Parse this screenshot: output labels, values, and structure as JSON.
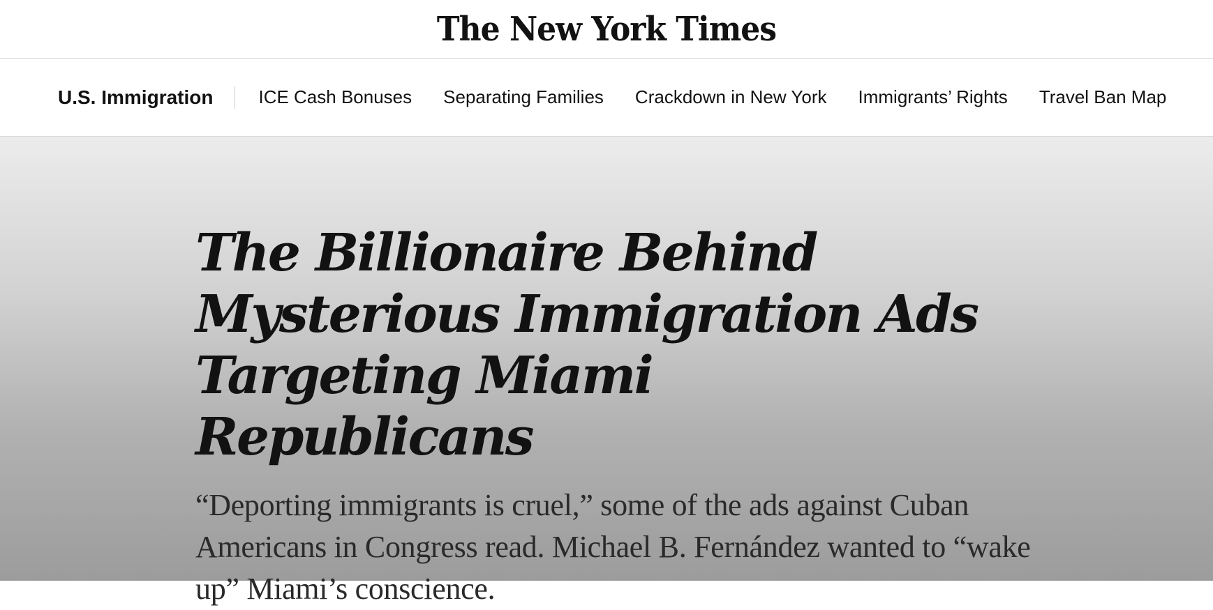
{
  "masthead": {
    "logo_text": "The New York Times"
  },
  "subnav": {
    "section_title": "U.S. Immigration",
    "links": [
      {
        "label": "ICE Cash Bonuses"
      },
      {
        "label": "Separating Families"
      },
      {
        "label": "Crackdown in New York"
      },
      {
        "label": "Immigrants’ Rights"
      },
      {
        "label": "Travel Ban Map"
      }
    ]
  },
  "article": {
    "headline": "The Billionaire Behind Mysterious Immigration Ads Targeting Miami Republicans",
    "summary": "“Deporting immigrants is cruel,” some of the ads against Cuban Americans in Congress read. Michael B. Fernández wanted to “wake up” Miami’s conscience."
  }
}
